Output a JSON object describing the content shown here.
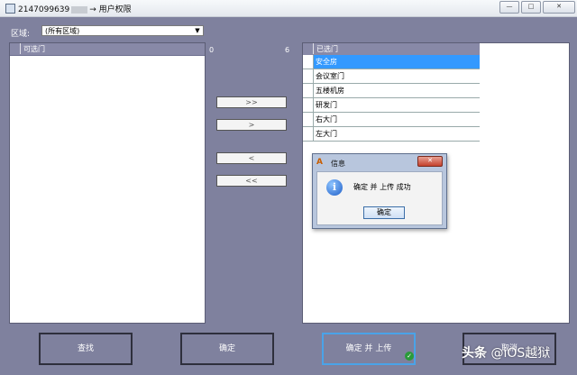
{
  "window": {
    "title_id": "2147099639",
    "title_suffix": "→ 用户权限",
    "controls": {
      "minimize": "—",
      "maximize": "□",
      "close": "✕"
    }
  },
  "region": {
    "label": "区域:",
    "value": "(所有区域)"
  },
  "available": {
    "header": "可选门",
    "count": "0"
  },
  "selected": {
    "header": "已选门",
    "count": "6",
    "items": [
      "安全房",
      "会议室门",
      "五楼机房",
      "研发门",
      "右大门",
      "左大门"
    ],
    "selected_index": 0
  },
  "transfer_buttons": {
    "add_all": ">>",
    "add": ">",
    "remove": "<",
    "remove_all": "<<"
  },
  "dialog": {
    "title": "信息",
    "message": "确定 并 上传   成功",
    "ok": "确定",
    "close": "✕"
  },
  "actions": {
    "query": "查找",
    "confirm": "确定",
    "confirm_upload": "确定 并 上传",
    "cancel": "取消"
  },
  "watermark": {
    "logo": "头条",
    "handle": "@iOS越狱"
  },
  "colors": {
    "panel": "#7f819e",
    "selection": "#3399ff",
    "focus_border": "#4aa3e8"
  }
}
